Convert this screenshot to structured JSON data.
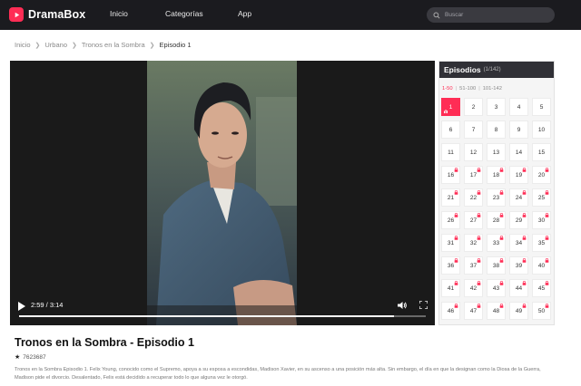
{
  "colors": {
    "brand": "#ff2d55",
    "topbar": "#1b1b1f",
    "panel_header": "#303036"
  },
  "app": {
    "name": "DramaBox",
    "logo_icon": "play-icon"
  },
  "nav": {
    "items": [
      "Inicio",
      "Categorías",
      "App"
    ]
  },
  "search": {
    "placeholder": "Buscar",
    "icon": "search-icon"
  },
  "breadcrumb": {
    "items": [
      "Inicio",
      "Urbano",
      "Tronos en la Sombra",
      "Episodio 1"
    ]
  },
  "player": {
    "time": "2:59 / 3:14",
    "progress": 0.922
  },
  "episode_info": {
    "title": "Tronos en la Sombra - Episodio 1",
    "rating": "7623687",
    "description": "Tronos en la Sombra Episodio 1. Felix Young, conocido como el Supremo, apoya a su esposa a escondidas, Madison Xavier, en su ascenso a una posición más alta. Sin embargo, el día en que la designan como la Diosa de la Guerra, Madison pide el divorcio. Desalentado, Felix está decidido a recuperar todo lo que alguna vez le otorgó."
  },
  "episodes": {
    "title": "Episodios",
    "count": "(1/142)",
    "ranges": [
      "1-50",
      "51-100",
      "101-142"
    ],
    "active_range": 0,
    "numbers": [
      1,
      2,
      3,
      4,
      5,
      6,
      7,
      8,
      9,
      10,
      11,
      12,
      13,
      14,
      15,
      16,
      17,
      18,
      19,
      20,
      21,
      22,
      23,
      24,
      25,
      26,
      27,
      28,
      29,
      30,
      31,
      32,
      33,
      34,
      35,
      36,
      37,
      38,
      39,
      40,
      41,
      42,
      43,
      44,
      45,
      46,
      47,
      48,
      49,
      50
    ],
    "active": 1,
    "first_locked": 16
  }
}
